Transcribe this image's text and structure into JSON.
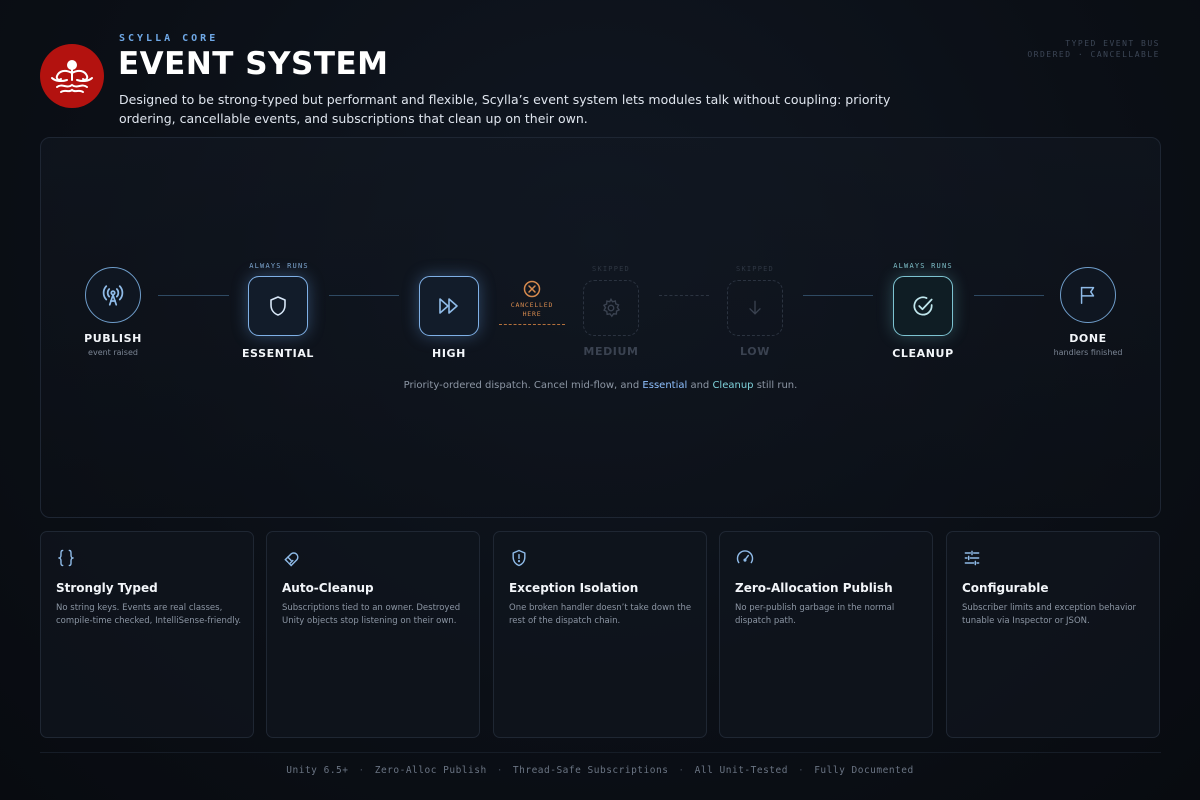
{
  "header": {
    "kicker": "SCYLLA CORE",
    "title": "EVENT SYSTEM",
    "description": "Designed to be strong-typed but performant and flexible, Scylla’s event system lets modules talk without coupling: priority ordering, cancellable events, and subscriptions that clean up on their own.",
    "tag_line_1": "TYPED EVENT BUS",
    "tag_line_2": "ORDERED · CANCELLABLE",
    "logo_color": "#b3120f"
  },
  "flow": {
    "nodes": [
      {
        "id": "publish",
        "label": "PUBLISH",
        "sub": "event raised",
        "icon": "broadcast-icon"
      },
      {
        "id": "essential",
        "label": "ESSENTIAL",
        "tag": "ALWAYS RUNS",
        "icon": "shield-icon"
      },
      {
        "id": "high",
        "label": "HIGH",
        "icon": "fast-forward-icon"
      },
      {
        "id": "medium",
        "label": "MEDIUM",
        "tag": "SKIPPED",
        "icon": "gear-icon"
      },
      {
        "id": "low",
        "label": "LOW",
        "tag": "SKIPPED",
        "icon": "arrow-down-icon"
      },
      {
        "id": "cleanup",
        "label": "CLEANUP",
        "tag": "ALWAYS RUNS",
        "icon": "check-circle-icon"
      },
      {
        "id": "done",
        "label": "DONE",
        "sub": "handlers finished",
        "icon": "flag-icon"
      }
    ],
    "cancel_line_1": "CANCELLED",
    "cancel_line_2": "HERE",
    "caption_before": "Priority-ordered dispatch. Cancel mid-flow, and ",
    "caption_essential": "Essential",
    "caption_and": " and ",
    "caption_cleanup": "Cleanup",
    "caption_after": " still run.",
    "accent_blue": "#7fb0e6",
    "accent_teal": "#7dc3d1",
    "accent_orange": "#d68a4e"
  },
  "cards": [
    {
      "icon": "braces-icon",
      "title": "Strongly Typed",
      "body": "No string keys. Events are real classes, compile-time checked, IntelliSense-friendly."
    },
    {
      "icon": "magnet-icon",
      "title": "Auto-Cleanup",
      "body": "Subscriptions tied to an owner. Destroyed Unity objects stop listening on their own."
    },
    {
      "icon": "shield-alert-icon",
      "title": "Exception Isolation",
      "body": "One broken handler doesn’t take down the rest of the dispatch chain."
    },
    {
      "icon": "gauge-icon",
      "title": "Zero-Allocation Publish",
      "body": "No per-publish garbage in the normal dispatch path."
    },
    {
      "icon": "sliders-icon",
      "title": "Configurable",
      "body": "Subscriber limits and exception behavior tunable via Inspector or JSON."
    }
  ],
  "footer": {
    "items": [
      "Unity 6.5+",
      "Zero-Alloc Publish",
      "Thread-Safe Subscriptions",
      "All Unit-Tested",
      "Fully Documented"
    ],
    "separator": "·"
  }
}
